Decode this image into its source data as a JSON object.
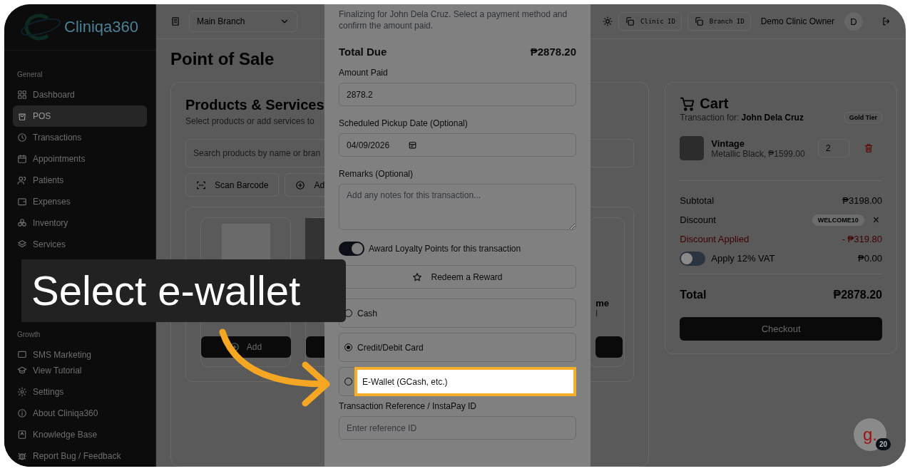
{
  "sidebar": {
    "logo": "Cliniqa360",
    "sections": [
      {
        "heading": "General",
        "items": [
          {
            "label": "Dashboard",
            "selected": false
          },
          {
            "label": "POS",
            "selected": true
          },
          {
            "label": "Transactions",
            "selected": false
          },
          {
            "label": "Appointments",
            "selected": false
          },
          {
            "label": "Patients",
            "selected": false
          },
          {
            "label": "Expenses",
            "selected": false
          },
          {
            "label": "Inventory",
            "selected": false
          },
          {
            "label": "Services",
            "selected": false
          }
        ]
      },
      {
        "heading": "Growth",
        "items": [
          {
            "label": "SMS Marketing",
            "selected": false
          }
        ]
      }
    ],
    "footer_items": [
      "View Tutorial",
      "Settings",
      "About Cliniqa360",
      "Knowledge Base",
      "Report Bug / Feedback"
    ]
  },
  "topbar": {
    "branch_select": "Main Branch",
    "chips": [
      "Clinic ID",
      "Branch ID"
    ],
    "user_name": "Demo Clinic Owner",
    "avatar": "D"
  },
  "page_title": "Point of Sale",
  "products": {
    "title": "Products & Services",
    "subtitle": "Select products or add services to",
    "search_placeholder": "Search products by name or bran",
    "actions": [
      "Scan Barcode",
      "Ad"
    ],
    "cards": [
      {
        "button": "Add"
      }
    ],
    "right_card": {
      "line_1": "me",
      "line_2": "l"
    }
  },
  "cart": {
    "title": "Cart",
    "customer": "Transaction for: **John Dela Cruz**",
    "tier": "Gold Tier",
    "items": [
      {
        "name": "Vintage",
        "detail": "Metallic Black, ₱1599.00",
        "quantity": "2"
      }
    ],
    "subtotal_label": "Subtotal",
    "subtotal": "₱3198.00",
    "discount_label": "Discount",
    "discount_code": "WELCOME10",
    "remove_symbol": "×",
    "applied_label": "Discount Applied",
    "applied_value": "- ₱319.80",
    "vat_label": "Apply 12% VAT",
    "vat_on": false,
    "vat_value": "₱0.00",
    "total_label": "Total",
    "total": "₱2878.20",
    "checkout": "Checkout"
  },
  "modal": {
    "description": "Finalizing for John Dela Cruz. Select a payment method and confirm the amount paid.",
    "total_label": "Total Due",
    "total": "₱2878.20",
    "amount_label": "Amount Paid",
    "amount_value": "2878.2",
    "pickup_label": "Scheduled Pickup Date (Optional)",
    "pickup_value": "04/09/2026",
    "remarks_label": "Remarks (Optional)",
    "remarks_placeholder": "Add any notes for this transaction...",
    "loyalty_label": "Award Loyalty Points for this transaction",
    "loyalty_on": true,
    "redeem_button": "Redeem a Reward",
    "payment_options": [
      {
        "label": "Cash",
        "selected": false,
        "highlight": false
      },
      {
        "label": "Credit/Debit Card",
        "selected": true,
        "highlight": false
      },
      {
        "label": "E-Wallet (GCash, etc.)",
        "selected": false,
        "highlight": true
      }
    ],
    "reference_label": "Transaction Reference / InstaPay ID",
    "reference_placeholder": "Enter reference ID"
  },
  "tutorial": {
    "caption": "Select e-wallet"
  },
  "help_badge": {
    "letter": "g.",
    "count": "20"
  }
}
